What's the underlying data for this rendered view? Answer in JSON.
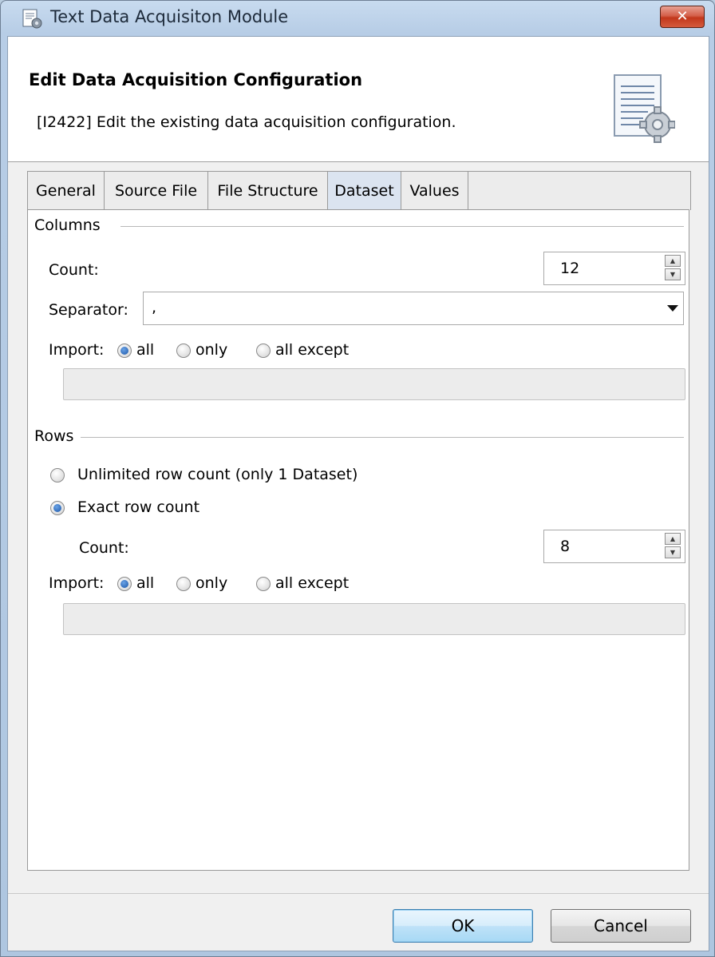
{
  "window": {
    "title": "Text Data Acquisiton Module",
    "close_label": "✕"
  },
  "header": {
    "title": "Edit Data Acquisition Configuration",
    "description": "[I2422] Edit the existing data acquisition configuration."
  },
  "tabs": [
    {
      "label": "General"
    },
    {
      "label": "Source File"
    },
    {
      "label": "File Structure"
    },
    {
      "label": "Dataset"
    },
    {
      "label": "Values"
    }
  ],
  "columns": {
    "group_label": "Columns",
    "count_label": "Count:",
    "count_value": "12",
    "separator_label": "Separator:",
    "separator_value": ",",
    "import_label": "Import:",
    "import_options": [
      "all",
      "only",
      "all except"
    ],
    "import_selected": "all"
  },
  "rows": {
    "group_label": "Rows",
    "unlimited_label": "Unlimited row count (only 1 Dataset)",
    "exact_label": "Exact row count",
    "count_label": "Count:",
    "count_value": "8",
    "import_label": "Import:",
    "import_options": [
      "all",
      "only",
      "all except"
    ],
    "import_selected": "all"
  },
  "buttons": {
    "ok": "OK",
    "cancel": "Cancel"
  }
}
